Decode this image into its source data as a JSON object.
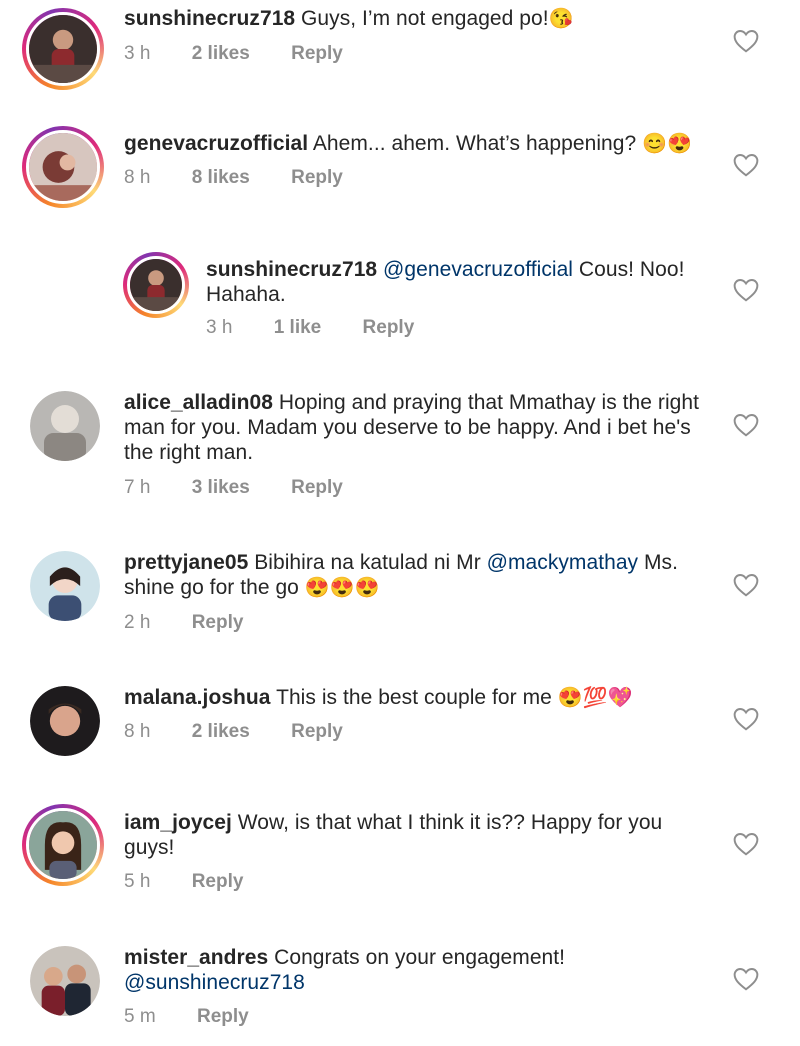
{
  "comments": [
    {
      "username": "sunshinecruz718",
      "text": "Guys, I’m not engaged po!",
      "emoji": "😘",
      "time": "3 h",
      "likes": "2 likes",
      "reply": "Reply"
    },
    {
      "username": "genevacruzofficial",
      "text": "Ahem... ahem. What’s happening?",
      "emoji": "😊😍",
      "time": "8 h",
      "likes": "8 likes",
      "reply": "Reply"
    },
    {
      "username": "sunshinecruz718",
      "mention": "@genevacruzofficial",
      "text": "Cous! Noo! Hahaha.",
      "time": "3 h",
      "likes": "1 like",
      "reply": "Reply"
    },
    {
      "username": "alice_alladin08",
      "text": "Hoping and praying that Mmathay is the right man for you. Madam you deserve to be happy. And i bet he's the right man.",
      "time": "7 h",
      "likes": "3 likes",
      "reply": "Reply"
    },
    {
      "username": "prettyjane05",
      "text_before": "Bibihira na katulad ni Mr",
      "mention": "@mackymathay",
      "text": "Ms. shine go for the go",
      "emoji": "😍😍😍",
      "time": "2 h",
      "reply": "Reply"
    },
    {
      "username": "malana.joshua",
      "text": "This is the best couple for me",
      "emoji": "😍💯💖",
      "time": "8 h",
      "likes": "2 likes",
      "reply": "Reply"
    },
    {
      "username": "iam_joycej",
      "text": "Wow, is that what I think it is?? Happy for you guys!",
      "time": "5 h",
      "reply": "Reply"
    },
    {
      "username": "mister_andres",
      "text": "Congrats on your engagement!",
      "mention": "@sunshinecruz718",
      "time": "5 m",
      "reply": "Reply"
    }
  ],
  "colors": {
    "text": "#262626",
    "meta": "#8e8e8e",
    "mention": "#003569",
    "heart_outline": "#8e8e8e"
  },
  "icons": {
    "like": "heart-outline-icon"
  }
}
